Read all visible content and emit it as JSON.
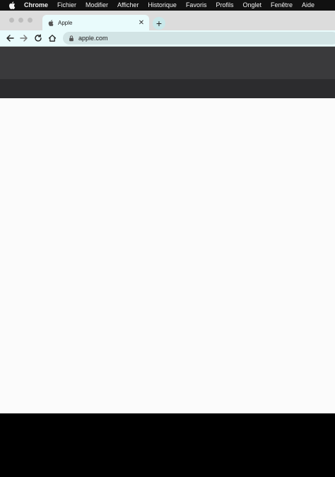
{
  "menubar": {
    "app": "Chrome",
    "items": [
      "Fichier",
      "Modifier",
      "Afficher",
      "Historique",
      "Favoris",
      "Profils",
      "Onglet",
      "Fenêtre",
      "Aide"
    ]
  },
  "tab": {
    "title": "Apple",
    "favicon": "apple-icon",
    "close_glyph": "✕"
  },
  "newtab": {
    "glyph": "+"
  },
  "toolbar": {
    "url": "apple.com"
  },
  "colors": {
    "tab_active": "#e9fbfc",
    "omnibox": "#d2e4e5",
    "page_header": "#3a3a3c",
    "page_body": "#fbfbfb"
  }
}
